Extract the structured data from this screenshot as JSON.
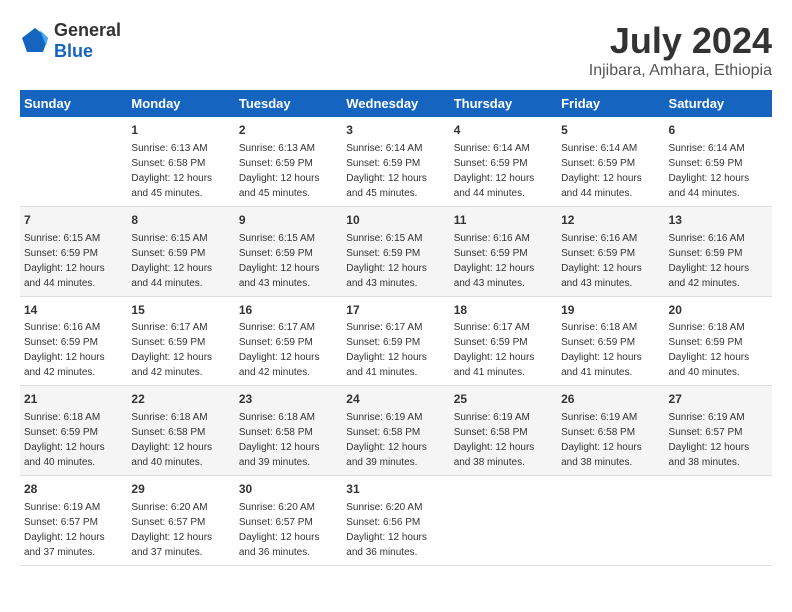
{
  "logo": {
    "general": "General",
    "blue": "Blue"
  },
  "title": "July 2024",
  "subtitle": "Injibara, Amhara, Ethiopia",
  "days_header": [
    "Sunday",
    "Monday",
    "Tuesday",
    "Wednesday",
    "Thursday",
    "Friday",
    "Saturday"
  ],
  "weeks": [
    [
      {
        "day": "",
        "sunrise": "",
        "sunset": "",
        "daylight": ""
      },
      {
        "day": "1",
        "sunrise": "Sunrise: 6:13 AM",
        "sunset": "Sunset: 6:58 PM",
        "daylight": "Daylight: 12 hours and 45 minutes."
      },
      {
        "day": "2",
        "sunrise": "Sunrise: 6:13 AM",
        "sunset": "Sunset: 6:59 PM",
        "daylight": "Daylight: 12 hours and 45 minutes."
      },
      {
        "day": "3",
        "sunrise": "Sunrise: 6:14 AM",
        "sunset": "Sunset: 6:59 PM",
        "daylight": "Daylight: 12 hours and 45 minutes."
      },
      {
        "day": "4",
        "sunrise": "Sunrise: 6:14 AM",
        "sunset": "Sunset: 6:59 PM",
        "daylight": "Daylight: 12 hours and 44 minutes."
      },
      {
        "day": "5",
        "sunrise": "Sunrise: 6:14 AM",
        "sunset": "Sunset: 6:59 PM",
        "daylight": "Daylight: 12 hours and 44 minutes."
      },
      {
        "day": "6",
        "sunrise": "Sunrise: 6:14 AM",
        "sunset": "Sunset: 6:59 PM",
        "daylight": "Daylight: 12 hours and 44 minutes."
      }
    ],
    [
      {
        "day": "7",
        "sunrise": "Sunrise: 6:15 AM",
        "sunset": "Sunset: 6:59 PM",
        "daylight": "Daylight: 12 hours and 44 minutes."
      },
      {
        "day": "8",
        "sunrise": "Sunrise: 6:15 AM",
        "sunset": "Sunset: 6:59 PM",
        "daylight": "Daylight: 12 hours and 44 minutes."
      },
      {
        "day": "9",
        "sunrise": "Sunrise: 6:15 AM",
        "sunset": "Sunset: 6:59 PM",
        "daylight": "Daylight: 12 hours and 43 minutes."
      },
      {
        "day": "10",
        "sunrise": "Sunrise: 6:15 AM",
        "sunset": "Sunset: 6:59 PM",
        "daylight": "Daylight: 12 hours and 43 minutes."
      },
      {
        "day": "11",
        "sunrise": "Sunrise: 6:16 AM",
        "sunset": "Sunset: 6:59 PM",
        "daylight": "Daylight: 12 hours and 43 minutes."
      },
      {
        "day": "12",
        "sunrise": "Sunrise: 6:16 AM",
        "sunset": "Sunset: 6:59 PM",
        "daylight": "Daylight: 12 hours and 43 minutes."
      },
      {
        "day": "13",
        "sunrise": "Sunrise: 6:16 AM",
        "sunset": "Sunset: 6:59 PM",
        "daylight": "Daylight: 12 hours and 42 minutes."
      }
    ],
    [
      {
        "day": "14",
        "sunrise": "Sunrise: 6:16 AM",
        "sunset": "Sunset: 6:59 PM",
        "daylight": "Daylight: 12 hours and 42 minutes."
      },
      {
        "day": "15",
        "sunrise": "Sunrise: 6:17 AM",
        "sunset": "Sunset: 6:59 PM",
        "daylight": "Daylight: 12 hours and 42 minutes."
      },
      {
        "day": "16",
        "sunrise": "Sunrise: 6:17 AM",
        "sunset": "Sunset: 6:59 PM",
        "daylight": "Daylight: 12 hours and 42 minutes."
      },
      {
        "day": "17",
        "sunrise": "Sunrise: 6:17 AM",
        "sunset": "Sunset: 6:59 PM",
        "daylight": "Daylight: 12 hours and 41 minutes."
      },
      {
        "day": "18",
        "sunrise": "Sunrise: 6:17 AM",
        "sunset": "Sunset: 6:59 PM",
        "daylight": "Daylight: 12 hours and 41 minutes."
      },
      {
        "day": "19",
        "sunrise": "Sunrise: 6:18 AM",
        "sunset": "Sunset: 6:59 PM",
        "daylight": "Daylight: 12 hours and 41 minutes."
      },
      {
        "day": "20",
        "sunrise": "Sunrise: 6:18 AM",
        "sunset": "Sunset: 6:59 PM",
        "daylight": "Daylight: 12 hours and 40 minutes."
      }
    ],
    [
      {
        "day": "21",
        "sunrise": "Sunrise: 6:18 AM",
        "sunset": "Sunset: 6:59 PM",
        "daylight": "Daylight: 12 hours and 40 minutes."
      },
      {
        "day": "22",
        "sunrise": "Sunrise: 6:18 AM",
        "sunset": "Sunset: 6:58 PM",
        "daylight": "Daylight: 12 hours and 40 minutes."
      },
      {
        "day": "23",
        "sunrise": "Sunrise: 6:18 AM",
        "sunset": "Sunset: 6:58 PM",
        "daylight": "Daylight: 12 hours and 39 minutes."
      },
      {
        "day": "24",
        "sunrise": "Sunrise: 6:19 AM",
        "sunset": "Sunset: 6:58 PM",
        "daylight": "Daylight: 12 hours and 39 minutes."
      },
      {
        "day": "25",
        "sunrise": "Sunrise: 6:19 AM",
        "sunset": "Sunset: 6:58 PM",
        "daylight": "Daylight: 12 hours and 38 minutes."
      },
      {
        "day": "26",
        "sunrise": "Sunrise: 6:19 AM",
        "sunset": "Sunset: 6:58 PM",
        "daylight": "Daylight: 12 hours and 38 minutes."
      },
      {
        "day": "27",
        "sunrise": "Sunrise: 6:19 AM",
        "sunset": "Sunset: 6:57 PM",
        "daylight": "Daylight: 12 hours and 38 minutes."
      }
    ],
    [
      {
        "day": "28",
        "sunrise": "Sunrise: 6:19 AM",
        "sunset": "Sunset: 6:57 PM",
        "daylight": "Daylight: 12 hours and 37 minutes."
      },
      {
        "day": "29",
        "sunrise": "Sunrise: 6:20 AM",
        "sunset": "Sunset: 6:57 PM",
        "daylight": "Daylight: 12 hours and 37 minutes."
      },
      {
        "day": "30",
        "sunrise": "Sunrise: 6:20 AM",
        "sunset": "Sunset: 6:57 PM",
        "daylight": "Daylight: 12 hours and 36 minutes."
      },
      {
        "day": "31",
        "sunrise": "Sunrise: 6:20 AM",
        "sunset": "Sunset: 6:56 PM",
        "daylight": "Daylight: 12 hours and 36 minutes."
      },
      {
        "day": "",
        "sunrise": "",
        "sunset": "",
        "daylight": ""
      },
      {
        "day": "",
        "sunrise": "",
        "sunset": "",
        "daylight": ""
      },
      {
        "day": "",
        "sunrise": "",
        "sunset": "",
        "daylight": ""
      }
    ]
  ]
}
